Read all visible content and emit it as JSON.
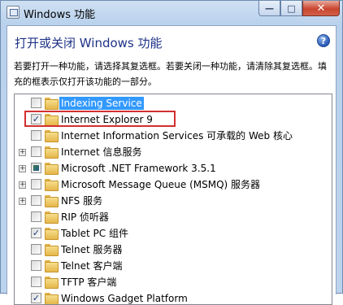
{
  "window": {
    "title": "Windows 功能",
    "icon": "windows-features-icon",
    "buttons": {
      "minimize": "—",
      "maximize": "□",
      "close": "✕"
    }
  },
  "header": {
    "title": "打开或关闭 Windows 功能",
    "help_icon": "?"
  },
  "description": "若要打开一种功能，请选择其复选框。若要关闭一种功能，请清除其复选框。填充的框表示仅打开该功能的一部分。",
  "features": [
    {
      "label": "Indexing Service",
      "state": "unchecked",
      "expandable": false,
      "selected": true
    },
    {
      "label": "Internet Explorer 9",
      "state": "checked",
      "expandable": false,
      "selected": false,
      "highlighted": true
    },
    {
      "label": "Internet Information Services 可承载的 Web 核心",
      "state": "unchecked",
      "expandable": false,
      "selected": false
    },
    {
      "label": "Internet 信息服务",
      "state": "unchecked",
      "expandable": true,
      "selected": false
    },
    {
      "label": "Microsoft .NET Framework 3.5.1",
      "state": "partial",
      "expandable": true,
      "selected": false
    },
    {
      "label": "Microsoft Message Queue (MSMQ) 服务器",
      "state": "unchecked",
      "expandable": true,
      "selected": false
    },
    {
      "label": "NFS 服务",
      "state": "unchecked",
      "expandable": true,
      "selected": false
    },
    {
      "label": "RIP 侦听器",
      "state": "unchecked",
      "expandable": false,
      "selected": false
    },
    {
      "label": "Tablet PC 组件",
      "state": "checked",
      "expandable": false,
      "selected": false
    },
    {
      "label": "Telnet 服务器",
      "state": "unchecked",
      "expandable": false,
      "selected": false
    },
    {
      "label": "Telnet 客户端",
      "state": "unchecked",
      "expandable": false,
      "selected": false
    },
    {
      "label": "TFTP 客户端",
      "state": "unchecked",
      "expandable": false,
      "selected": false
    },
    {
      "label": "Windows Gadget Platform",
      "state": "checked",
      "expandable": false,
      "selected": false
    }
  ],
  "colors": {
    "selection": "#3399ff",
    "header_title": "#1e3287",
    "annotation_box": "#d32f2f"
  }
}
